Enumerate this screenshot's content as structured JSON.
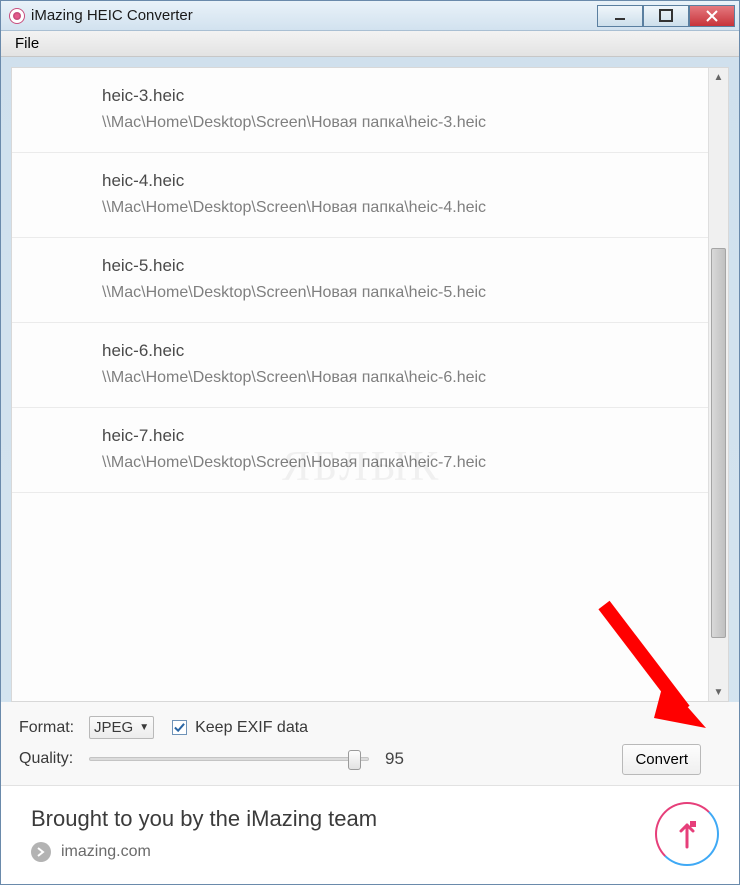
{
  "window": {
    "title": "iMazing HEIC Converter"
  },
  "menubar": {
    "file": "File"
  },
  "files": [
    {
      "name": "heic-3.heic",
      "path": "\\\\Mac\\Home\\Desktop\\Screen\\Новая папка\\heic-3.heic"
    },
    {
      "name": "heic-4.heic",
      "path": "\\\\Mac\\Home\\Desktop\\Screen\\Новая папка\\heic-4.heic"
    },
    {
      "name": "heic-5.heic",
      "path": "\\\\Mac\\Home\\Desktop\\Screen\\Новая папка\\heic-5.heic"
    },
    {
      "name": "heic-6.heic",
      "path": "\\\\Mac\\Home\\Desktop\\Screen\\Новая папка\\heic-6.heic"
    },
    {
      "name": "heic-7.heic",
      "path": "\\\\Mac\\Home\\Desktop\\Screen\\Новая папка\\heic-7.heic"
    }
  ],
  "controls": {
    "format_label": "Format:",
    "format_value": "JPEG",
    "keep_exif_label": "Keep EXIF data",
    "keep_exif_checked": true,
    "quality_label": "Quality:",
    "quality_value": "95",
    "convert_label": "Convert"
  },
  "footer": {
    "tagline": "Brought to you by the iMazing team",
    "link_text": "imazing.com"
  },
  "watermark": "ЯБЛЫК"
}
